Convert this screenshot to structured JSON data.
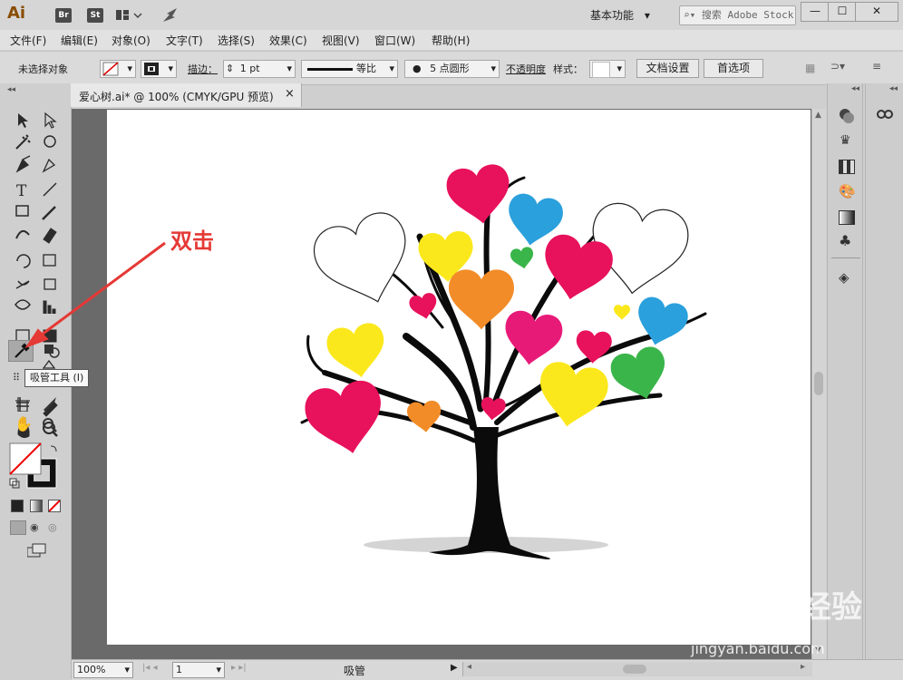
{
  "app": {
    "logo": "Ai",
    "bridge": "Br",
    "stock": "St",
    "workspace": "基本功能",
    "search_placeholder": "搜索 Adobe Stock"
  },
  "menu": [
    "文件(F)",
    "编辑(E)",
    "对象(O)",
    "文字(T)",
    "选择(S)",
    "效果(C)",
    "视图(V)",
    "窗口(W)",
    "帮助(H)"
  ],
  "control": {
    "selection": "未选择对象",
    "stroke_label": "描边：",
    "stroke_value": "1 pt",
    "profile": "等比",
    "brush": "5 点圆形",
    "opacity_label": "不透明度",
    "style_label": "样式：",
    "doc_setup": "文档设置",
    "prefs": "首选项"
  },
  "document": {
    "tab": "爱心树.ai* @ 100% (CMYK/GPU 预览)",
    "close": "×"
  },
  "tooltip": "吸管工具 (I)",
  "annotation": "双击",
  "status": {
    "zoom": "100%",
    "page": "1",
    "tool": "吸管"
  },
  "watermark": {
    "main": "Baidu 经验",
    "url": "jingyan.baidu.com"
  },
  "colors": {
    "magenta": "#e8115b",
    "blue": "#2aa0dc",
    "yellow": "#fbe81c",
    "orange": "#f28c28",
    "green": "#3ab54a",
    "pink": "#e81a78",
    "annotation_red": "#e53935"
  }
}
